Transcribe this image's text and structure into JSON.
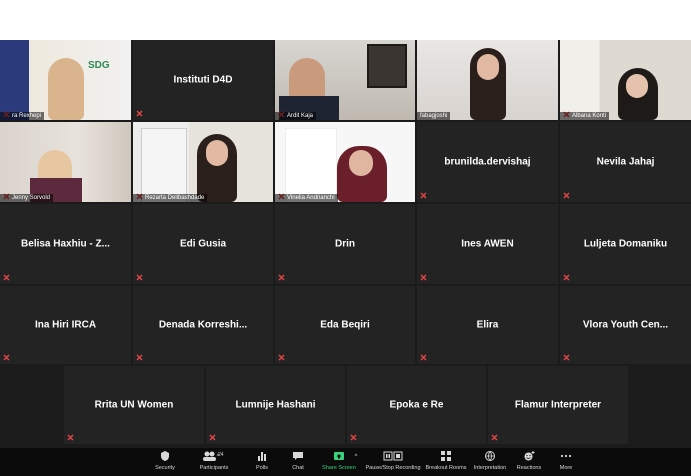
{
  "participants_count": "24",
  "tiles": [
    {
      "label": "ra Rexhepi",
      "type": "video"
    },
    {
      "label": "Instituti D4D",
      "type": "name"
    },
    {
      "label": "Ardit Kaja",
      "type": "video"
    },
    {
      "label": "fabagjoshi",
      "type": "video",
      "active": true
    },
    {
      "label": "Albana Konti",
      "type": "video"
    },
    {
      "label": "Jenny Sorvold",
      "type": "video"
    },
    {
      "label": "Rezarta Delibashdade",
      "type": "video"
    },
    {
      "label": "Vinelia Andrianchi",
      "type": "video"
    },
    {
      "label": "brunilda.dervishaj",
      "type": "name"
    },
    {
      "label": "Nevila Jahaj",
      "type": "name"
    },
    {
      "label": "Belisa Haxhiu - Z...",
      "type": "name"
    },
    {
      "label": "Edi Gusia",
      "type": "name"
    },
    {
      "label": "Drin",
      "type": "name"
    },
    {
      "label": "Ines AWEN",
      "type": "name"
    },
    {
      "label": "Luljeta Domaniku",
      "type": "name"
    },
    {
      "label": "Ina Hiri IRCA",
      "type": "name"
    },
    {
      "label": "Denada  Korreshi...",
      "type": "name"
    },
    {
      "label": "Eda Beqiri",
      "type": "name"
    },
    {
      "label": "Elira",
      "type": "name"
    },
    {
      "label": "Vlora Youth Cen...",
      "type": "name"
    },
    {
      "label": "Rrita UN Women",
      "type": "name"
    },
    {
      "label": "Lumnije Hashani",
      "type": "name"
    },
    {
      "label": "Epoka e Re",
      "type": "name"
    },
    {
      "label": "Flamur Interpreter",
      "type": "name"
    }
  ],
  "toolbar": {
    "security": "Security",
    "participants": "Participants",
    "polls": "Polls",
    "chat": "Chat",
    "share_screen": "Share Screen",
    "pause_recording": "Pause/Stop Recording",
    "breakout_rooms": "Breakout Rooms",
    "interpretation": "Interpretation",
    "reactions": "Reactions",
    "more": "More"
  },
  "colors": {
    "active_speaker": "#b6d94f",
    "mute_icon": "#e04545",
    "share_screen": "#39d17a"
  }
}
